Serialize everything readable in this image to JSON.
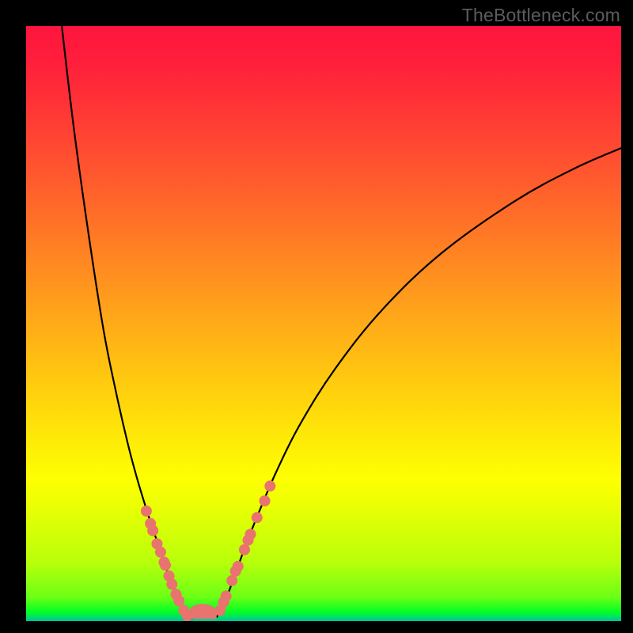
{
  "watermark": "TheBottleneck.com",
  "colors": {
    "dot": "#e8736f",
    "curve": "#000000",
    "gradient_top": "#ff153e",
    "gradient_bottom": "#00c1a4"
  },
  "chart_data": {
    "type": "line",
    "title": "",
    "xlabel": "",
    "ylabel": "",
    "xlim": [
      0,
      100
    ],
    "ylim": [
      0,
      100
    ],
    "grid": false,
    "series": [
      {
        "name": "left_curve",
        "x": [
          6.0,
          8.0,
          10.5,
          13.0,
          15.0,
          17.0,
          18.5,
          20.0,
          21.5,
          23.0,
          24.0,
          25.0,
          26.0,
          27.0,
          28.0
        ],
        "y": [
          100.0,
          83.0,
          65.0,
          49.0,
          39.0,
          30.2,
          24.5,
          19.5,
          14.9,
          10.5,
          7.6,
          5.1,
          3.0,
          1.5,
          0.4
        ]
      },
      {
        "name": "right_curve",
        "x": [
          32.0,
          33.5,
          35.0,
          37.0,
          39.0,
          42.0,
          46.0,
          52.0,
          60.0,
          70.0,
          82.0,
          92.0,
          100.0
        ],
        "y": [
          0.6,
          3.5,
          7.5,
          13.0,
          18.0,
          25.0,
          33.0,
          42.5,
          52.5,
          62.0,
          70.5,
          76.0,
          79.5
        ]
      }
    ],
    "markers": {
      "name": "highlight_dots",
      "x": [
        20.2,
        20.9,
        21.3,
        22.0,
        22.6,
        23.2,
        23.4,
        24.0,
        24.5,
        25.2,
        25.7,
        26.5,
        27.1,
        32.6,
        33.2,
        33.6,
        34.6,
        35.2,
        35.6,
        36.7,
        37.3,
        37.7,
        38.8,
        40.1,
        41.0
      ],
      "y": [
        18.5,
        16.4,
        15.2,
        13.0,
        11.6,
        9.9,
        9.4,
        7.6,
        6.2,
        4.5,
        3.4,
        1.8,
        0.9,
        1.8,
        3.2,
        4.2,
        6.8,
        8.4,
        9.2,
        12.0,
        13.6,
        14.6,
        17.4,
        20.2,
        22.7
      ],
      "r": 7
    },
    "bottom_lobe": {
      "x": [
        27.3,
        32.0
      ],
      "y": [
        0.4,
        0.4
      ],
      "height": 2.5
    }
  }
}
